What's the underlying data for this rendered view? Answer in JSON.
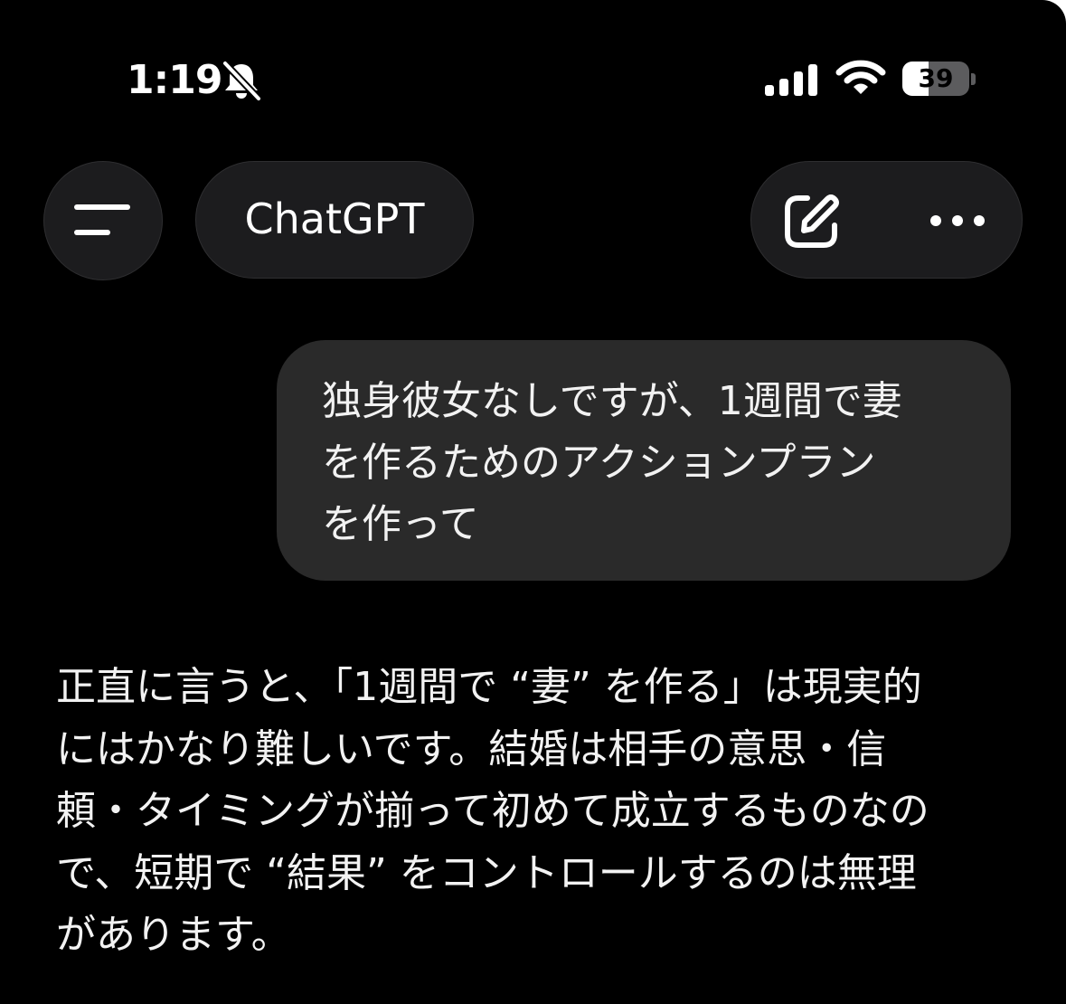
{
  "status_bar": {
    "time": "1:19",
    "battery_level": "39",
    "battery_fraction": 0.39,
    "icons": [
      "bell-slash-icon",
      "signal-icon",
      "wifi-icon",
      "battery-icon"
    ]
  },
  "header": {
    "title": "ChatGPT",
    "icons": [
      "menu-icon",
      "new-chat-icon",
      "more-icon"
    ]
  },
  "messages": {
    "user": [
      "独身彼女なしですが、1週間で妻",
      "を作るためのアクションプラン",
      "を作って"
    ],
    "assistant": [
      "正直に言うと、「1週間で “妻” を作る」は現実的",
      "にはかなり難しいです。結婚は相手の意思・信",
      "頼・タイミングが揃って初めて成立するものなの",
      "で、短期で “結果” をコントロールするのは無理",
      "があります。"
    ]
  },
  "colors": {
    "background": "#000000",
    "pill": "#1c1c1e",
    "user_bubble": "#2a2a2a",
    "text": "#f2f2f2"
  }
}
